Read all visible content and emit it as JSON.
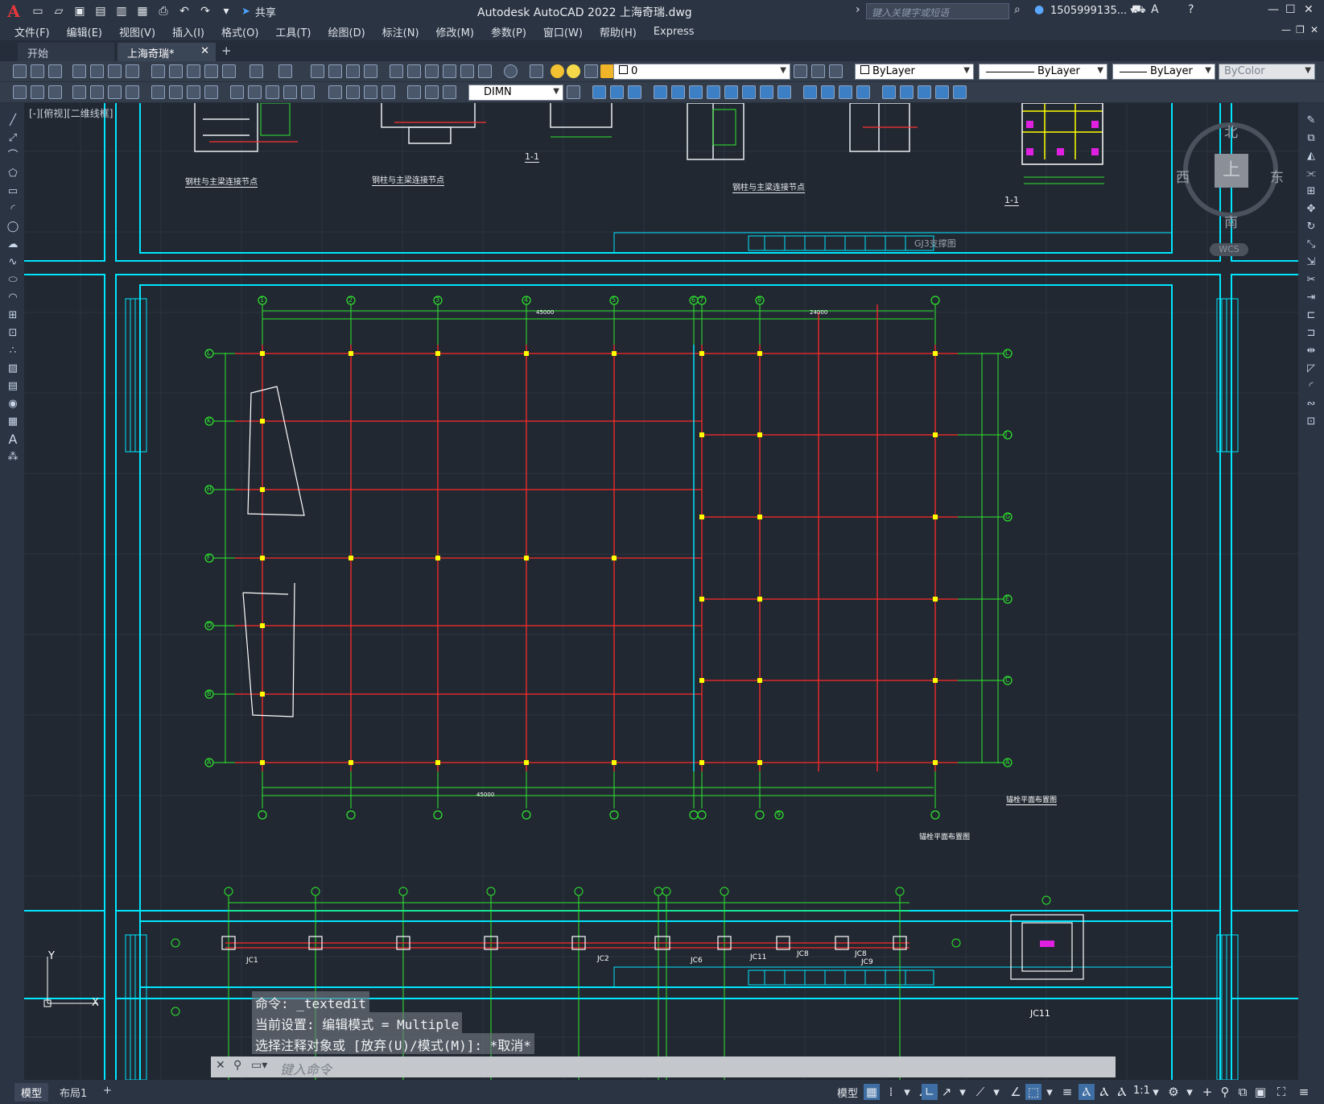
{
  "app": {
    "title": "Autodesk AutoCAD 2022   上海奇瑞.dwg",
    "share_label": "共享",
    "search_placeholder": "键入关键字或短语",
    "user": "1505999135... ▾"
  },
  "menu": [
    "文件(F)",
    "编辑(E)",
    "视图(V)",
    "插入(I)",
    "格式(O)",
    "工具(T)",
    "绘图(D)",
    "标注(N)",
    "修改(M)",
    "参数(P)",
    "窗口(W)",
    "帮助(H)",
    "Express"
  ],
  "tabs": {
    "start": "开始",
    "document": "上海奇瑞*",
    "close": "✕",
    "add": "+"
  },
  "toolbar": {
    "layer_value": "0",
    "color_value": "ByLayer",
    "linetype_value": "ByLayer",
    "lineweight_value": "ByLayer",
    "plotstyle_value": "ByColor",
    "dimstyle_value": "DIMN"
  },
  "viewport": {
    "label": "[-][俯视][二维线框]"
  },
  "viewcube": {
    "face": "上",
    "north": "北",
    "south": "南",
    "east": "东",
    "west": "西",
    "wcs": "WCS"
  },
  "drawing": {
    "title_main": "锚栓平面布置图",
    "title_sheet": "锚栓平面布置图",
    "title_top": "GJ3支撑图",
    "detail_label1": "钢柱与主梁连接节点",
    "detail_label2": "钢柱与主梁连接节点",
    "detail_label3": "钢柱与主梁连接节点",
    "section_a": "1-1",
    "section_b": "1-1",
    "grid_top": [
      "1",
      "2",
      "3",
      "4",
      "5",
      "6",
      "7",
      "8",
      "9"
    ],
    "grid_left": [
      "L",
      "K",
      "H",
      "F",
      "D",
      "B",
      "A"
    ],
    "grid_right": [
      "L",
      "J",
      "G",
      "E",
      "C",
      "A"
    ],
    "overall_dim_top": "45000",
    "overall_dim_right": "24000",
    "bottom_labels": [
      "JC1",
      "JC2",
      "JC6",
      "JC11",
      "JC8",
      "JC8",
      "JC9",
      "JC11"
    ]
  },
  "command": {
    "history": [
      "命令: _textedit",
      "当前设置: 编辑模式 = Multiple",
      "选择注释对象或 [放弃(U)/模式(M)]: *取消*"
    ],
    "placeholder": "键入命令"
  },
  "status": {
    "layout_tabs": [
      "模型",
      "布局1"
    ],
    "add_tab": "+",
    "model_label": "模型",
    "scale": "1:1"
  }
}
